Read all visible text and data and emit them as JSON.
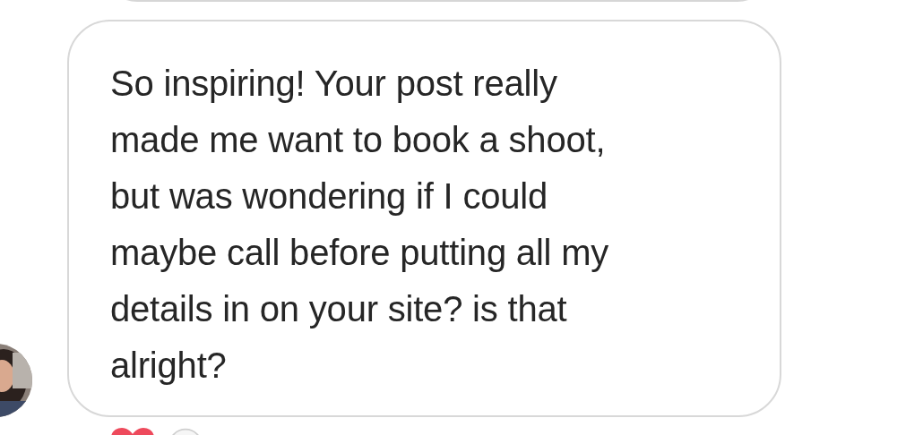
{
  "messages": [
    {
      "kind": "previous"
    },
    {
      "kind": "incoming",
      "text": "So inspiring! Your post really\nmade me want to book a shoot,\nbut was wondering if I could\nmaybe call before putting all my\ndetails in on your site? is that\nalright?"
    }
  ]
}
